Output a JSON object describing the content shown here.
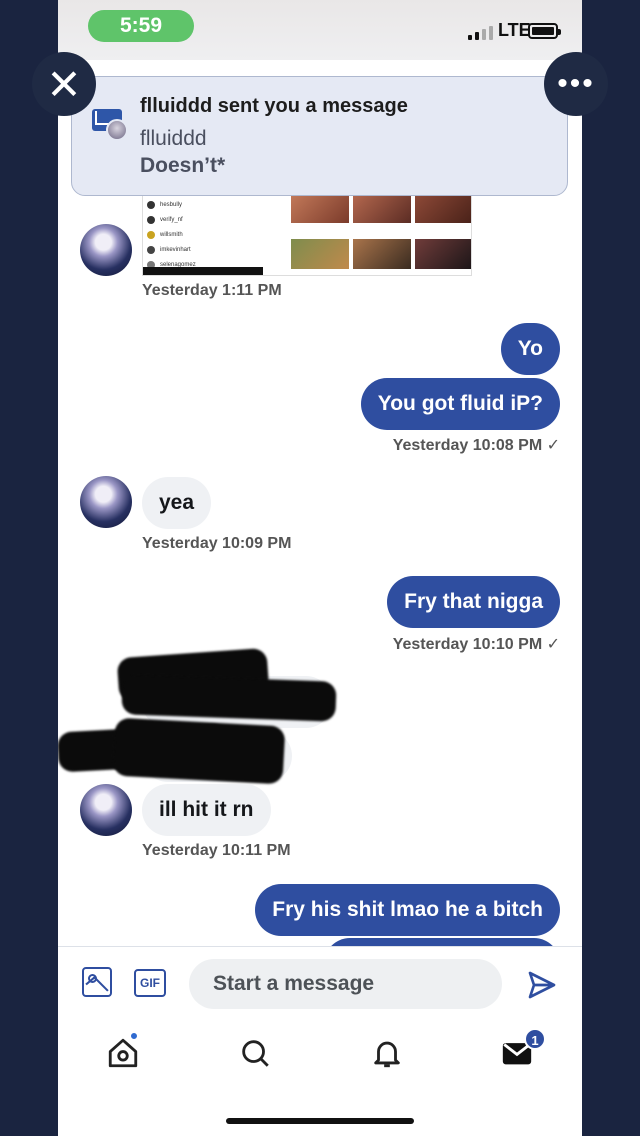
{
  "status_bar": {
    "time": "5:59",
    "network": "LTE"
  },
  "notification": {
    "title": "flluiddd sent you a message",
    "sender": "flluiddd",
    "body": "Doesn’t*"
  },
  "shared_image": {
    "rows": [
      "hesbully",
      "verify_nf",
      "willsmith",
      "imkevinhart",
      "selenagomez"
    ]
  },
  "messages": [
    {
      "type": "incoming-image",
      "timestamp": "Yesterday 1:11 PM"
    },
    {
      "type": "outgoing",
      "text": "Yo"
    },
    {
      "type": "outgoing",
      "text": "You got fluid iP?",
      "timestamp": "Yesterday 10:08 PM ✓"
    },
    {
      "type": "incoming",
      "text": "yea",
      "timestamp": "Yesterday 10:09 PM"
    },
    {
      "type": "outgoing",
      "text": "Fry that nigga",
      "timestamp": "Yesterday 10:10 PM ✓"
    },
    {
      "type": "incoming",
      "text": "ill hit it rn",
      "timestamp": "Yesterday 10:11 PM"
    },
    {
      "type": "outgoing",
      "text": "Fry his shit lmao he a bitch"
    }
  ],
  "compose": {
    "placeholder": "Start a message",
    "gif_label": "GIF"
  },
  "tabbar": {
    "messages_badge": "1"
  },
  "icons": {
    "close": "close-icon",
    "more": "more-icon",
    "image": "image-icon",
    "gif": "gif-icon",
    "send": "send-icon",
    "home": "home-icon",
    "search": "search-icon",
    "notifications": "bell-icon",
    "messages": "mail-icon"
  },
  "colors": {
    "accent": "#2f4ea0",
    "background": "#1a2440",
    "incoming_bubble": "#eff1f4"
  }
}
